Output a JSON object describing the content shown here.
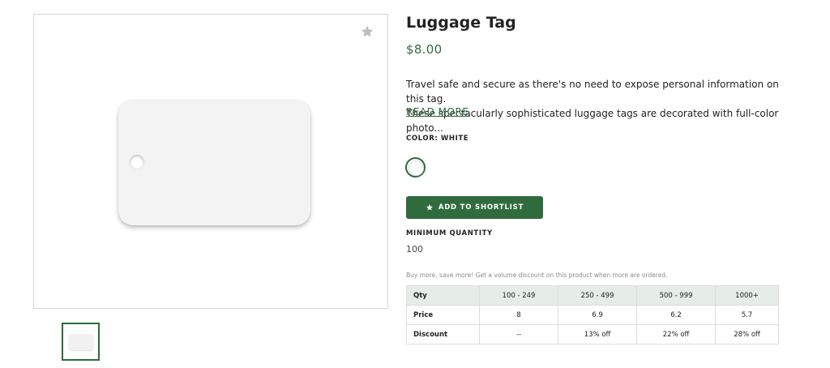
{
  "product": {
    "title": "Luggage Tag",
    "price": "$8.00",
    "description_line1": "Travel safe and secure as there's no need to expose personal information on this tag.",
    "description_line2": "These spectacularly sophisticated luggage tags are decorated with full-color photo...",
    "read_more": "READ MORE",
    "color_label": "COLOR: WHITE",
    "shortlist_label": "ADD TO SHORTLIST",
    "min_qty_label": "MINIMUM QUANTITY",
    "min_qty_value": "100",
    "bulk_note": "Buy more, save more! Get a volume discount on this product when more are ordered."
  },
  "pricing_table": {
    "header": [
      "Qty",
      "100 - 249",
      "250 - 499",
      "500 - 999",
      "1000+"
    ],
    "rows": [
      [
        "Price",
        "8",
        "6.9",
        "6.2",
        "5.7"
      ],
      [
        "Discount",
        "--",
        "13% off",
        "22% off",
        "28% off"
      ]
    ]
  },
  "colors": {
    "accent": "#2f6b3c",
    "table_header_bg": "#e6ece7",
    "swatch": "#ffffff"
  },
  "icons": {
    "favorite": "star-icon",
    "shortlist": "star-icon"
  }
}
